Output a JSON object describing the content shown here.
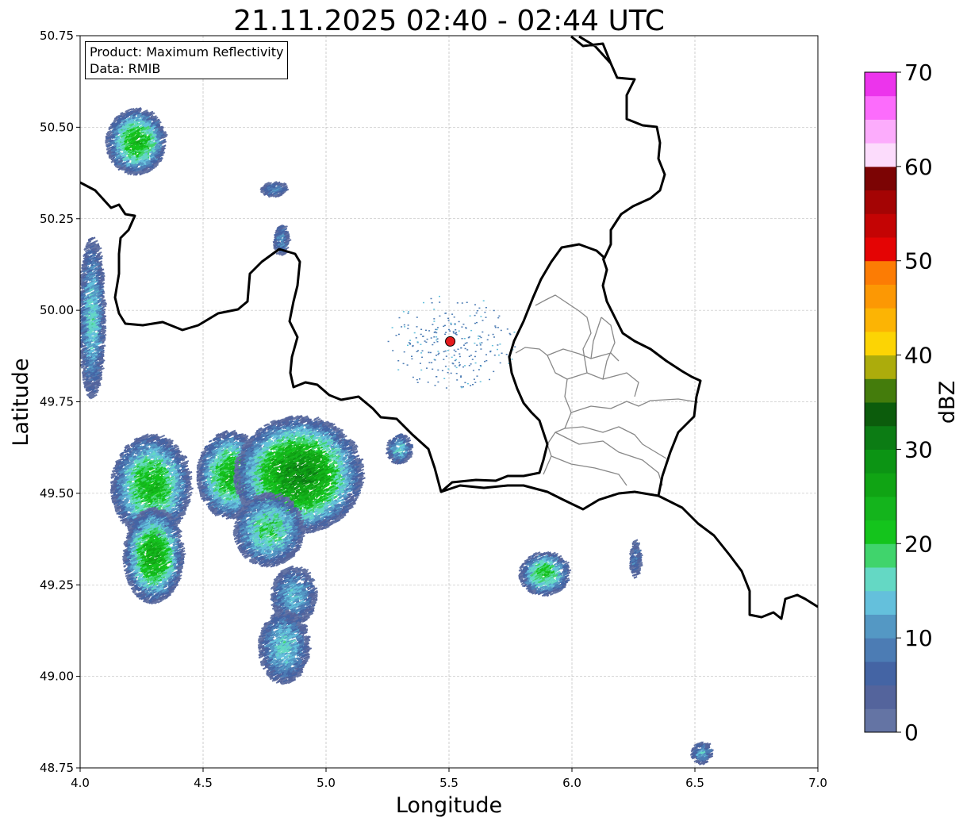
{
  "title": "21.11.2025 02:40 - 02:44 UTC",
  "info": {
    "product": "Product: Maximum Reflectivity",
    "data": "Data: RMIB"
  },
  "axes": {
    "xlabel": "Longitude",
    "ylabel": "Latitude",
    "xlim": [
      4.0,
      7.0
    ],
    "ylim": [
      48.75,
      50.75
    ],
    "xticks": [
      "4.0",
      "4.5",
      "5.0",
      "5.5",
      "6.0",
      "6.5",
      "7.0"
    ],
    "yticks": [
      "48.75",
      "49.00",
      "49.25",
      "49.50",
      "49.75",
      "50.00",
      "50.25",
      "50.50",
      "50.75"
    ],
    "grid": true
  },
  "radar_site": {
    "lon": 5.505,
    "lat": 49.915,
    "color": "#e41a1c"
  },
  "colorbar": {
    "label": "dBZ",
    "ticks": [
      "0",
      "10",
      "20",
      "30",
      "40",
      "50",
      "60",
      "70"
    ],
    "min": 0,
    "max": 70,
    "step": 2.5,
    "colors": [
      "#6474a4",
      "#54649c",
      "#4464a4",
      "#4c7cb4",
      "#5498c4",
      "#64c0dc",
      "#64d8c4",
      "#40d46c",
      "#14c41c",
      "#14b41c",
      "#10a414",
      "#0c9414",
      "#0c7c14",
      "#0c5c0c",
      "#447c0c",
      "#acac0c",
      "#fcd404",
      "#fcb404",
      "#fc9804",
      "#fc7c04",
      "#e40404",
      "#c40404",
      "#a40404",
      "#7c0404",
      "#fcdcfc",
      "#fcacfc",
      "#fc6cfc",
      "#ec34ec"
    ]
  },
  "precip_cells": [
    {
      "lon": 4.22,
      "lat": 50.46,
      "rx": 0.12,
      "ry": 0.09,
      "peak": 22
    },
    {
      "lon": 4.04,
      "lat": 49.98,
      "rx": 0.05,
      "ry": 0.22,
      "peak": 14
    },
    {
      "lon": 4.28,
      "lat": 49.52,
      "rx": 0.16,
      "ry": 0.14,
      "peak": 22
    },
    {
      "lon": 4.29,
      "lat": 49.33,
      "rx": 0.12,
      "ry": 0.13,
      "peak": 24
    },
    {
      "lon": 4.6,
      "lat": 49.55,
      "rx": 0.13,
      "ry": 0.12,
      "peak": 22
    },
    {
      "lon": 4.88,
      "lat": 49.55,
      "rx": 0.26,
      "ry": 0.16,
      "peak": 28
    },
    {
      "lon": 4.76,
      "lat": 49.4,
      "rx": 0.14,
      "ry": 0.1,
      "peak": 18
    },
    {
      "lon": 4.86,
      "lat": 49.22,
      "rx": 0.09,
      "ry": 0.08,
      "peak": 12
    },
    {
      "lon": 4.82,
      "lat": 49.08,
      "rx": 0.1,
      "ry": 0.1,
      "peak": 14
    },
    {
      "lon": 5.88,
      "lat": 49.28,
      "rx": 0.1,
      "ry": 0.06,
      "peak": 20
    },
    {
      "lon": 4.81,
      "lat": 50.19,
      "rx": 0.03,
      "ry": 0.04,
      "peak": 10
    },
    {
      "lon": 4.78,
      "lat": 50.33,
      "rx": 0.05,
      "ry": 0.02,
      "peak": 8
    },
    {
      "lon": 6.25,
      "lat": 49.32,
      "rx": 0.02,
      "ry": 0.05,
      "peak": 8
    },
    {
      "lon": 6.52,
      "lat": 48.79,
      "rx": 0.04,
      "ry": 0.03,
      "peak": 12
    },
    {
      "lon": 5.29,
      "lat": 49.62,
      "rx": 0.05,
      "ry": 0.04,
      "peak": 14
    }
  ]
}
